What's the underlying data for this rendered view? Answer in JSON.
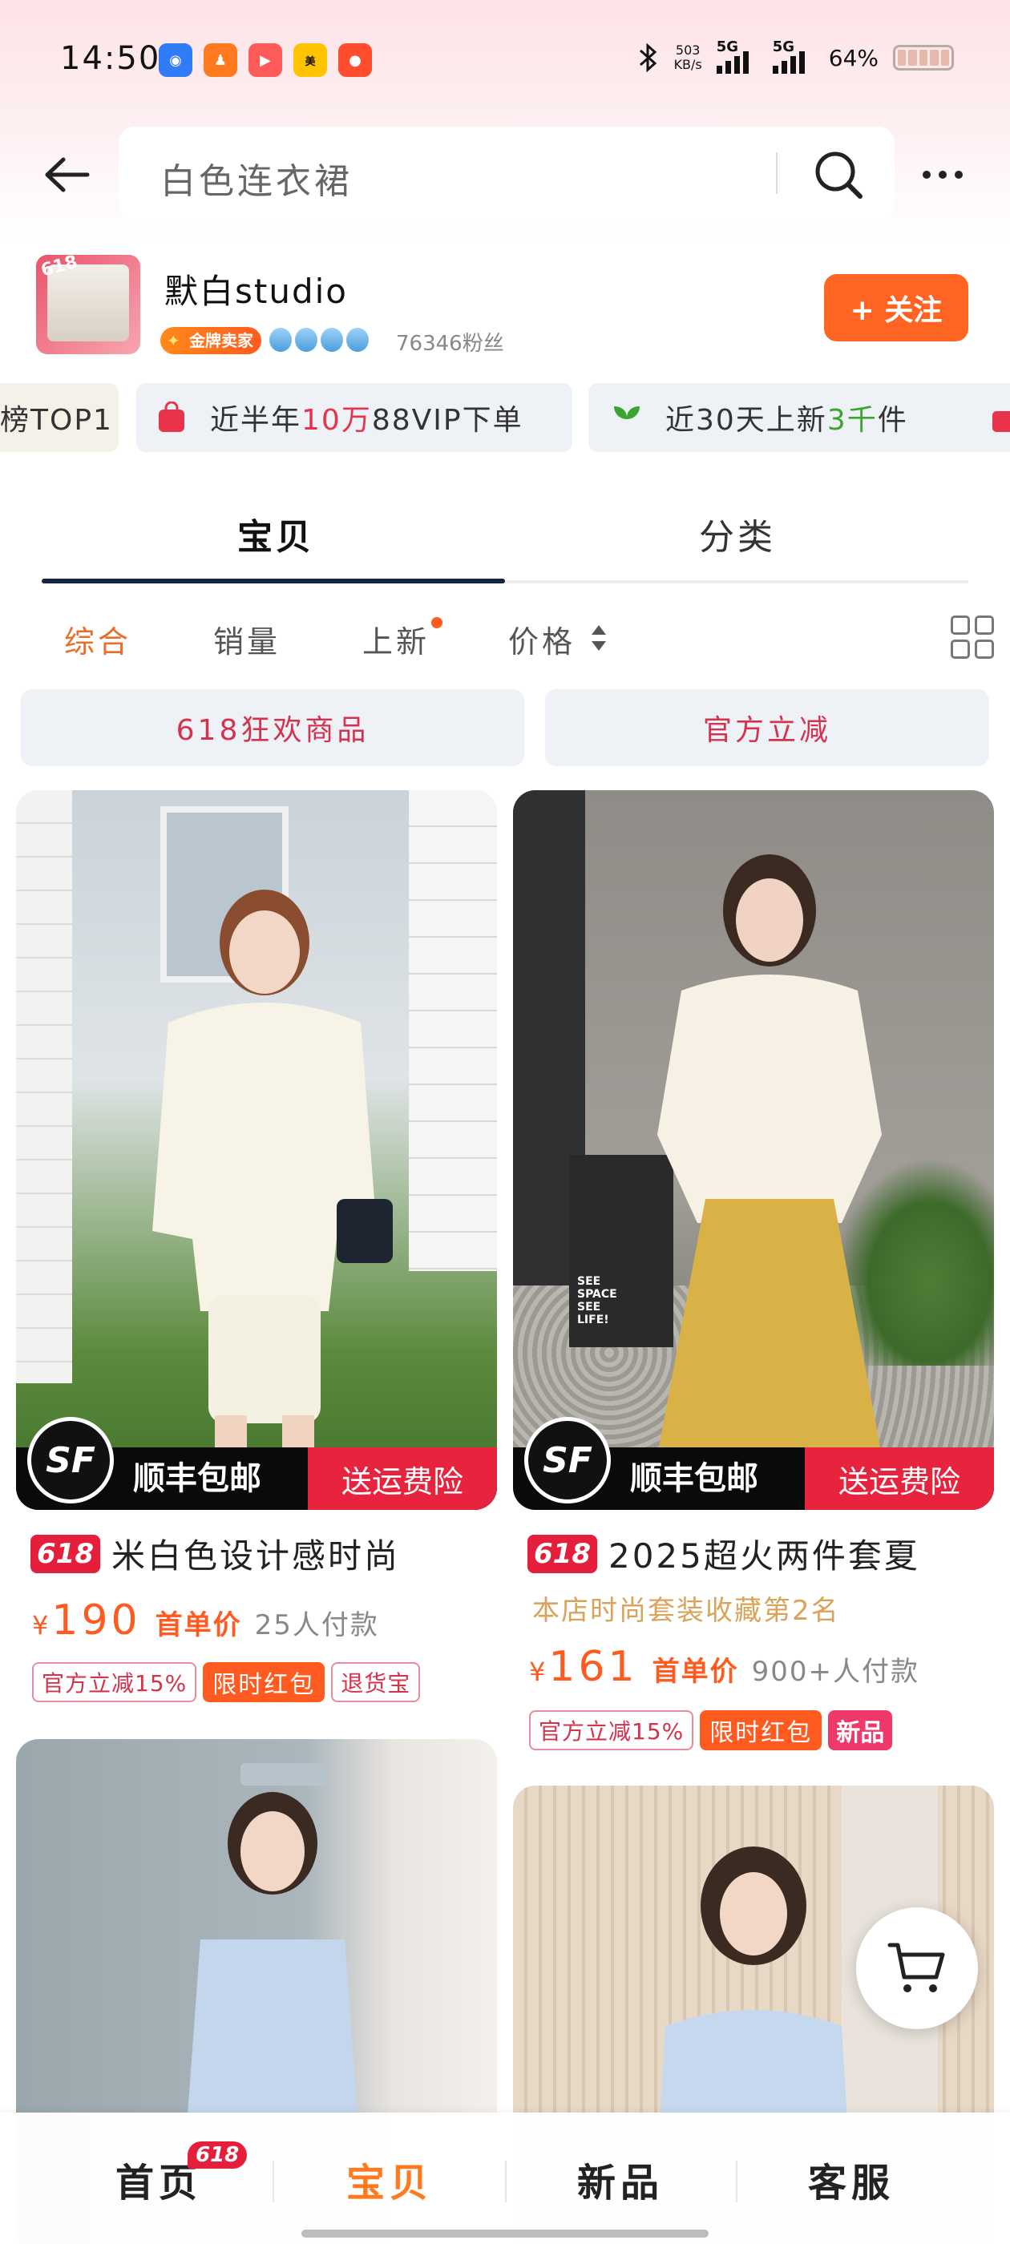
{
  "status_bar": {
    "time": "14:50",
    "net_speed_value": "503",
    "net_speed_unit": "KB/s",
    "signal1": "5G",
    "signal2": "5G",
    "battery": "64%"
  },
  "search": {
    "query": "白色连衣裙"
  },
  "shop": {
    "avatar_badge": "618",
    "name": "默白studio",
    "level_badge": "金牌卖家",
    "fans": "76346粉丝",
    "follow_label": "+ 关注"
  },
  "highlights": [
    {
      "text": "榜TOP1"
    },
    {
      "prefix": "近半年",
      "highlight": "10万",
      "suffix": "88VIP下单"
    },
    {
      "prefix": "近30天上新",
      "highlight": "3千",
      "suffix": "件"
    }
  ],
  "tabs": [
    {
      "label": "宝贝",
      "active": true
    },
    {
      "label": "分类",
      "active": false
    }
  ],
  "sort": [
    {
      "label": "综合",
      "active": true
    },
    {
      "label": "销量"
    },
    {
      "label": "上新"
    },
    {
      "label": "价格"
    }
  ],
  "promos": [
    {
      "label": "618狂欢商品"
    },
    {
      "label": "官方立减"
    }
  ],
  "products": [
    {
      "sf_label": "顺丰包邮",
      "insurance_label": "送运费险",
      "tag": "618",
      "title": "米白色设计感时尚",
      "currency": "¥",
      "price": "190",
      "price_label": "首单价",
      "buyers": "25人付款",
      "tags": [
        "官方立减15%",
        "限时红包",
        "退货宝"
      ]
    },
    {
      "sf_label": "顺丰包邮",
      "insurance_label": "送运费险",
      "tag": "618",
      "title": "2025超火两件套夏",
      "rank": "本店时尚套装收藏第2名",
      "currency": "¥",
      "price": "161",
      "price_label": "首单价",
      "buyers": "900+人付款",
      "tags": [
        "官方立减15%",
        "限时红包",
        "新品"
      ]
    }
  ],
  "bottom_nav": {
    "badge": "618",
    "items": [
      {
        "label": "首页"
      },
      {
        "label": "宝贝",
        "active": true
      },
      {
        "label": "新品"
      },
      {
        "label": "客服"
      }
    ]
  },
  "colors": {
    "accent_orange": "#ff5a1f",
    "follow_button": "#ff6422",
    "promo_red": "#e51e3b",
    "tab_indicator": "#14243c"
  },
  "icons": [
    "back-arrow-icon",
    "search-icon",
    "more-icon",
    "cart-icon",
    "grid-view-icon",
    "bag-icon",
    "leaf-icon",
    "sf-express-logo"
  ]
}
